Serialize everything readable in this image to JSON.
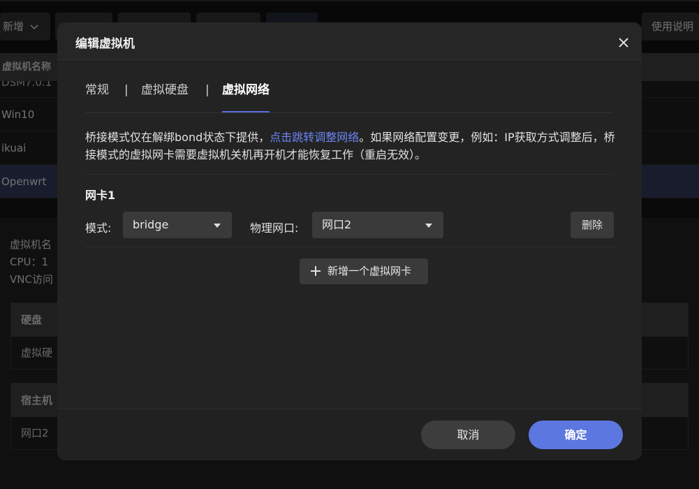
{
  "background": {
    "toolbar": {
      "new_label": "新增",
      "help_label": "使用说明"
    },
    "table": {
      "header": "虚拟机名称",
      "partial_row": "DSM7.0.1",
      "rows": [
        "Win10",
        "ikuai",
        "Openwrt"
      ]
    },
    "detail": {
      "name_label": "虚拟机名",
      "cpu_label": "CPU：1",
      "vnc_label": "VNC访问",
      "disk_section": {
        "title": "硬盘",
        "cell": "虚拟硬"
      },
      "host_section": {
        "title": "宿主机",
        "cell": "网口2"
      }
    }
  },
  "modal": {
    "title": "编辑虚拟机",
    "tabs": [
      {
        "label": "常规"
      },
      {
        "label": "虚拟硬盘"
      },
      {
        "label": "虚拟网络",
        "active": true
      }
    ],
    "tab_separator": "|",
    "notice": {
      "before_link": "桥接模式仅在解绑bond状态下提供，",
      "link": "点击跳转调整网络",
      "after_link": "。如果网络配置变更，例如：IP获取方式调整后，桥接模式的虚拟网卡需要虚拟机关机再开机才能恢复工作（重启无效）。"
    },
    "nic": {
      "title": "网卡1",
      "mode_label": "模式:",
      "mode_value": "bridge",
      "port_label": "物理网口:",
      "port_value": "网口2",
      "delete_label": "删除"
    },
    "add_nic_label": "新增一个虚拟网卡",
    "cancel_label": "取消",
    "ok_label": "确定"
  },
  "colors": {
    "accent": "#5d77e0",
    "link": "#6b84f5",
    "selected_row": "#2c3350"
  }
}
